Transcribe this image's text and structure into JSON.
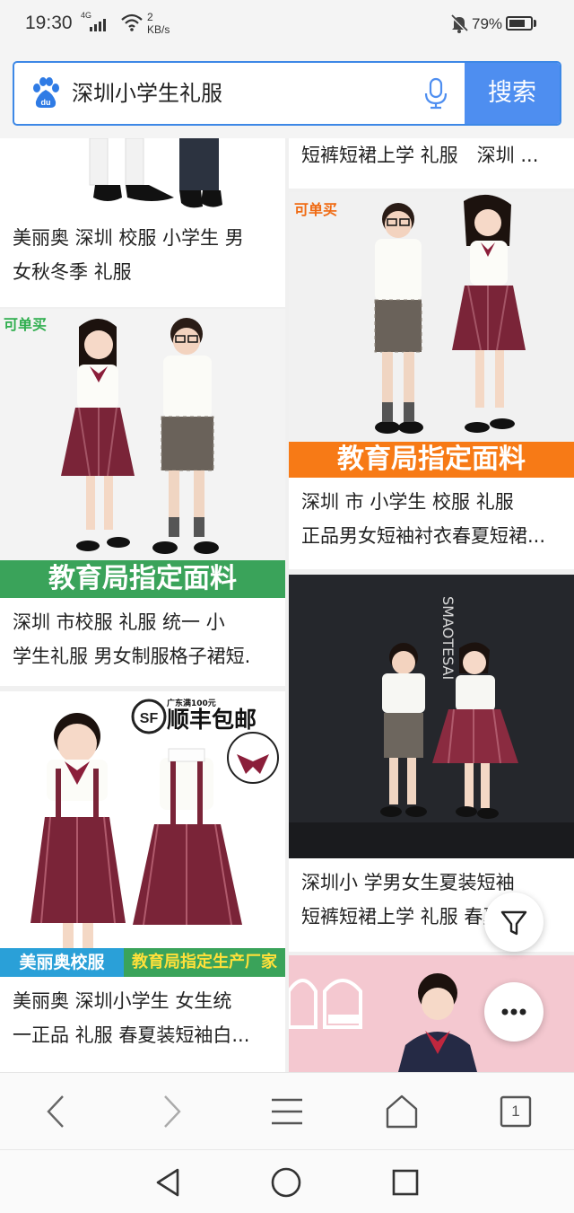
{
  "status_bar": {
    "time": "19:30",
    "network": "4G",
    "speed_value": "2",
    "speed_unit": "KB/s",
    "battery_pct": "79%",
    "battery_level": 0.79
  },
  "search": {
    "query": "深圳小学生礼服",
    "button_label": "搜索",
    "logo_text": "du"
  },
  "products": [
    {
      "title_lines": [
        "美丽奥 深圳 校服 小学生 男",
        "女秋冬季 礼服"
      ]
    },
    {
      "title_lines": [
        "短裤短裙上学 礼服　深圳 ..."
      ]
    },
    {
      "tag": "可单买",
      "banner": "教育局指定面料",
      "title_lines": [
        " 深圳 市校服 礼服 统一 小",
        "学生礼服 男女制服格子裙短."
      ]
    },
    {
      "tag": "可单买",
      "banner": "教育局指定面料",
      "title_lines": [
        " 深圳 市 小学生 校服 礼服",
        "正品男女短袖衬衣春夏短裙..."
      ]
    },
    {
      "badge_small": "广东满100元",
      "badge_main": "顺丰包邮",
      "banner_left": "美丽奥校服",
      "banner_right": "教育局指定生产厂家",
      "title_lines": [
        "美丽奥 深圳小学生 女生统",
        "一正品 礼服 春夏装短袖白..."
      ]
    },
    {
      "wall_text": "SMAOTESAI",
      "title_lines": [
        " 深圳小 学男女生夏装短袖",
        "短裤短裙上学 礼服 春夏深.."
      ]
    },
    {
      "title_lines": []
    }
  ],
  "colors": {
    "accent": "#4e8ef0",
    "banner_green": "#3aa35a",
    "banner_orange": "#f77a16",
    "tag_green": "#2fae4e"
  },
  "toolbar": {
    "tab_count": "1"
  },
  "icons": [
    "back-arrow-icon",
    "forward-arrow-icon",
    "menu-icon",
    "home-icon",
    "tabs-icon",
    "filter-icon",
    "more-icon",
    "mic-icon",
    "baidu-logo-icon",
    "nav-back-icon",
    "nav-home-icon",
    "nav-recents-icon",
    "bell-off-icon",
    "wifi-icon",
    "signal-icon",
    "battery-icon"
  ]
}
